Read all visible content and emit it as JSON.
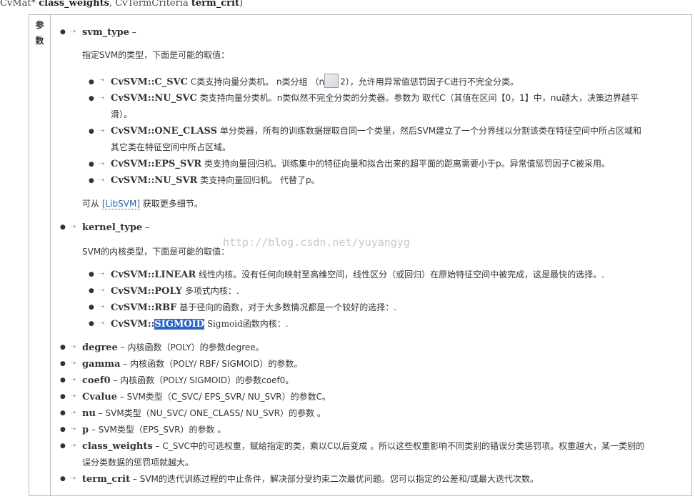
{
  "signature": {
    "type1": "CvMat*",
    "param1": "class_weights",
    "sep": ",",
    "type2": "CvTermCriteria",
    "param2": "term_crit",
    "close": ")"
  },
  "label_col": [
    "参",
    "数"
  ],
  "watermark": "http://blog.csdn.net/yuyangyg",
  "svm_type": {
    "term": "svm_type",
    "dash": " –",
    "intro": "指定SVM的类型，下面是可能的取值：",
    "items": [
      {
        "term": "CvSVM::C_SVC",
        "desc_a": " C类支持向量分类机。 n类分组  （n",
        "desc_b": "2），允许用异常值惩罚因子C进行不完全分类。"
      },
      {
        "term": "CvSVM::NU_SVC",
        "desc": " 类支持向量分类机。n类似然不完全分类的分类器。参数为 取代C（其值在区间【0，1】中，nu越大，决策边界越平"
      },
      {
        "term": "",
        "desc": "滑）。"
      },
      {
        "term": "CvSVM::ONE_CLASS",
        "desc": " 单分类器，所有的训练数据提取自同一个类里，然后SVM建立了一个分界线以分割该类在特征空间中所占区域和"
      },
      {
        "term": "",
        "desc": "其它类在特征空间中所占区域。"
      },
      {
        "term": "CvSVM::EPS_SVR",
        "desc": " 类支持向量回归机。训练集中的特征向量和拟合出来的超平面的距离需要小于p。异常值惩罚因子C被采用。"
      },
      {
        "term": "CvSVM::NU_SVR",
        "desc": " 类支持向量回归机。 代替了p。"
      }
    ],
    "more_a": "可从 ",
    "more_link": "[LibSVM]",
    "more_b": " 获取更多细节。"
  },
  "kernel_type": {
    "term": "kernel_type",
    "dash": " –",
    "intro": "SVM的内核类型，下面是可能的取值：",
    "items": [
      {
        "term": "CvSVM::LINEAR",
        "desc": " 线性内核。没有任何向映射至高维空间，线性区分（或回归）在原始特征空间中被完成，这是最快的选择。."
      },
      {
        "term": "CvSVM::POLY",
        "desc": " 多项式内核：."
      },
      {
        "term": "CvSVM::RBF",
        "desc": " 基于径向的函数，对于大多数情况都是一个较好的选择：."
      },
      {
        "term_pre": "CvSVM::",
        "term_hl": "SIGMOID",
        "desc": " Sigmoid函数内核：."
      }
    ]
  },
  "params": [
    {
      "term": "degree",
      "desc": " – 内核函数（POLY）的参数degree。"
    },
    {
      "term": "gamma",
      "desc": " – 内核函数（POLY/ RBF/ SIGMOID）的参数。"
    },
    {
      "term": "coef0",
      "desc": " – 内核函数（POLY/ SIGMOID）的参数coef0。"
    },
    {
      "term": "Cvalue",
      "desc": " – SVM类型（C_SVC/ EPS_SVR/ NU_SVR）的参数C。"
    },
    {
      "term": "nu",
      "desc": " – SVM类型（NU_SVC/ ONE_CLASS/ NU_SVR）的参数 。"
    },
    {
      "term": "p",
      "desc": " – SVM类型（EPS_SVR）的参数 。"
    },
    {
      "term": "class_weights",
      "desc": " – C_SVC中的可选权重，赋给指定的类，乘以C以后变成 。所以这些权重影响不同类别的错误分类惩罚项。权重越大，某一类别的"
    },
    {
      "term": "",
      "desc": "误分类数据的惩罚项就越大。"
    },
    {
      "term": "term_crit",
      "desc": " – SVM的迭代训练过程的中止条件，解决部分受约束二次最优问题。您可以指定的公差和/或最大迭代次数。"
    }
  ]
}
